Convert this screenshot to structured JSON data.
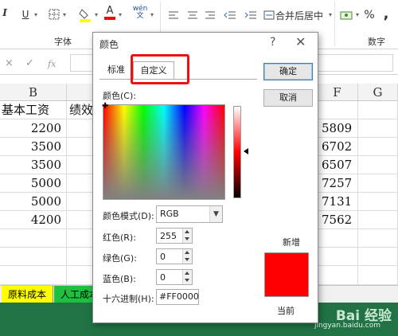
{
  "ribbon": {
    "font_group_label": "字体",
    "number_group_label": "数字",
    "underline_label": "U",
    "font_color_label": "A",
    "phonetic_label": "wén\n文",
    "merge_center_label": "合并后居中",
    "percent_label": "%",
    "comma_label": ","
  },
  "formula_bar": {
    "cancel_icon": "×",
    "enter_icon": "✓",
    "fx_label": "fx"
  },
  "grid": {
    "col_b_header": "B",
    "col_f_header": "F",
    "col_g_header": "G",
    "b1": "基本工资",
    "c1_partial": "绩效",
    "b_values": [
      "2200",
      "3500",
      "3500",
      "5000",
      "5000",
      "4200"
    ],
    "f_values": [
      "5809",
      "6702",
      "6507",
      "7257",
      "7131",
      "7562"
    ]
  },
  "sheet_tabs": [
    "原料成本",
    "人工成本"
  ],
  "watermark": {
    "text": "Bai 经验",
    "url": "jingyan.baidu.com"
  },
  "dialog": {
    "title": "颜色",
    "help": "?",
    "close": "✕",
    "tab_standard": "标准",
    "tab_custom": "自定义",
    "ok": "确定",
    "cancel": "取消",
    "colors_label": "颜色(C):",
    "color_mode_label": "颜色模式(D):",
    "color_mode_value": "RGB",
    "red_label": "红色(R):",
    "red_value": "255",
    "green_label": "绿色(G):",
    "green_value": "0",
    "blue_label": "蓝色(B):",
    "blue_value": "0",
    "hex_label": "十六进制(H):",
    "hex_value": "#FF0000",
    "new_label": "新增",
    "current_label": "当前",
    "selected_color": "#FF0000"
  }
}
